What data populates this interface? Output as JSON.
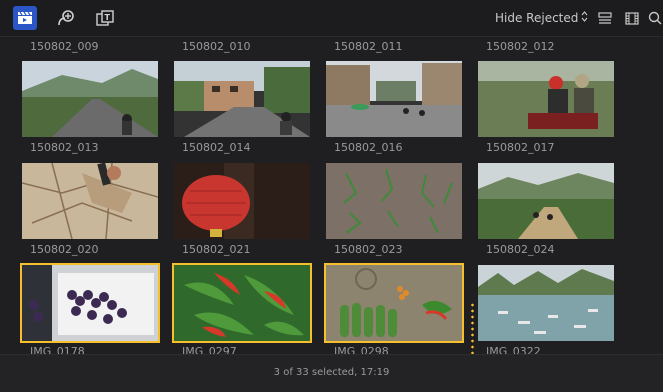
{
  "toolbar": {
    "left_icons": [
      "clapper-icon",
      "media-icon",
      "titles-icon"
    ],
    "filter_label": "Hide Rejected",
    "right_icons": [
      "list-view-icon",
      "filmstrip-icon",
      "search-icon"
    ],
    "accent": "#2a56c6"
  },
  "clips": [
    {
      "name": "150802_009",
      "selected": false
    },
    {
      "name": "150802_010",
      "selected": false
    },
    {
      "name": "150802_011",
      "selected": false
    },
    {
      "name": "150802_012",
      "selected": false
    },
    {
      "name": "150802_013",
      "selected": false
    },
    {
      "name": "150802_014",
      "selected": false
    },
    {
      "name": "150802_016",
      "selected": false
    },
    {
      "name": "150802_017",
      "selected": false
    },
    {
      "name": "150802_020",
      "selected": false
    },
    {
      "name": "150802_021",
      "selected": false
    },
    {
      "name": "150802_023",
      "selected": false
    },
    {
      "name": "150802_024",
      "selected": false
    },
    {
      "name": "IMG_0178",
      "selected": true
    },
    {
      "name": "IMG_0297",
      "selected": true
    },
    {
      "name": "IMG_0298",
      "selected": true
    },
    {
      "name": "IMG_0322",
      "selected": false
    }
  ],
  "selection_color": "#f5c02c",
  "status": "3 of 33 selected, 17:19"
}
